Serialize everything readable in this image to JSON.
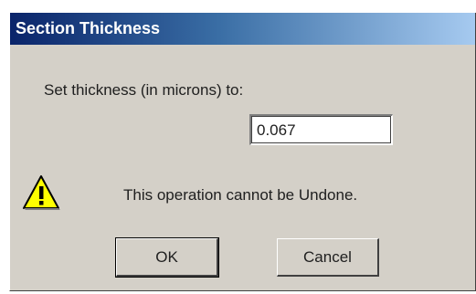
{
  "dialog": {
    "title": "Section Thickness",
    "prompt": "Set thickness (in microns) to:",
    "thickness_value": "0.067",
    "warning_message": "This operation cannot be Undone.",
    "ok_label": "OK",
    "cancel_label": "Cancel"
  },
  "icons": {
    "warning": "warning-icon"
  },
  "colors": {
    "titlebar_start": "#0a246a",
    "titlebar_end": "#a6caf0",
    "dialog_bg": "#d4d0c8",
    "warning_yellow": "#ffff00"
  }
}
